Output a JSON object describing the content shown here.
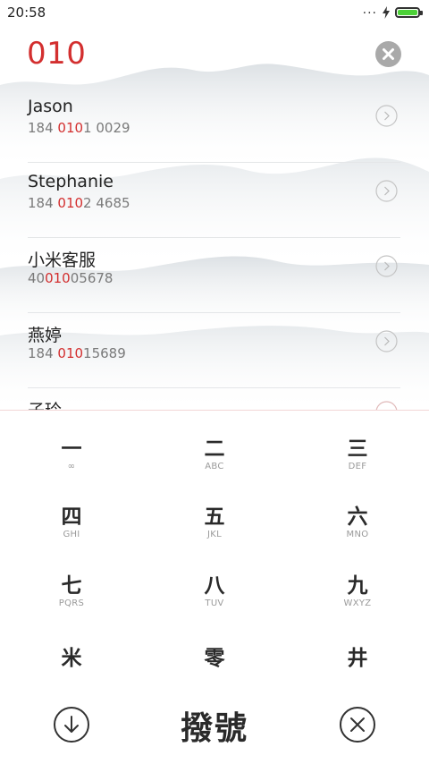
{
  "status": {
    "time": "20:58",
    "dots": "...",
    "icons": [
      "more-dots-icon",
      "charging-bolt-icon",
      "battery-icon"
    ],
    "battery_color": "#4cd137"
  },
  "dialer": {
    "dialed_number": "010",
    "accent_color": "#d32f2f",
    "clear_icon": "clear-x-icon"
  },
  "contacts": [
    {
      "name": "Jason",
      "number_pre": "184 ",
      "number_match": "010",
      "number_post": "1 0029"
    },
    {
      "name": "Stephanie",
      "number_pre": "184 ",
      "number_match": "010",
      "number_post": "2 4685"
    },
    {
      "name": "小米客服",
      "number_pre": "40",
      "number_match": "010",
      "number_post": "05678"
    },
    {
      "name": "燕婷",
      "number_pre": "184 ",
      "number_match": "010",
      "number_post": "15689"
    },
    {
      "name": "子玲",
      "number_pre": "",
      "number_match": "",
      "number_post": ""
    }
  ],
  "keypad": {
    "keys": [
      {
        "glyph": "一",
        "sub": "∞"
      },
      {
        "glyph": "二",
        "sub": "ABC"
      },
      {
        "glyph": "三",
        "sub": "DEF"
      },
      {
        "glyph": "四",
        "sub": "GHI"
      },
      {
        "glyph": "五",
        "sub": "JKL"
      },
      {
        "glyph": "六",
        "sub": "MNO"
      },
      {
        "glyph": "七",
        "sub": "PQRS"
      },
      {
        "glyph": "八",
        "sub": "TUV"
      },
      {
        "glyph": "九",
        "sub": "WXYZ"
      },
      {
        "glyph": "米",
        "sub": ""
      },
      {
        "glyph": "零",
        "sub": ""
      },
      {
        "glyph": "井",
        "sub": ""
      }
    ],
    "dial_label": "撥號",
    "collapse_icon": "arrow-down-circle-icon",
    "delete_icon": "close-circle-icon"
  }
}
